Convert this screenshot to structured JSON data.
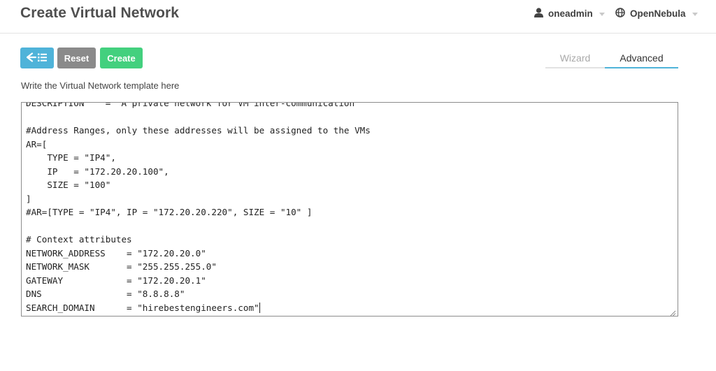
{
  "header": {
    "title": "Create Virtual Network",
    "user": {
      "name": "oneadmin",
      "icon": "user-icon"
    },
    "zone": {
      "name": "OpenNebula",
      "icon": "globe-icon"
    }
  },
  "toolbar": {
    "back_icon": "back-list-icon",
    "reset_label": "Reset",
    "create_label": "Create",
    "colors": {
      "back": "#4fb3d9",
      "reset": "#8a8a8a",
      "create": "#43d07e"
    }
  },
  "tabs": [
    {
      "label": "Wizard",
      "active": false
    },
    {
      "label": "Advanced",
      "active": true
    }
  ],
  "editor": {
    "instructions": "Write the Virtual Network template here",
    "lines": [
      "DESCRIPTION    = \"A private network for VM inter-communication\"",
      "",
      "#Address Ranges, only these addresses will be assigned to the VMs",
      "AR=[",
      "    TYPE = \"IP4\",",
      "    IP   = \"172.20.20.100\",",
      "    SIZE = \"100\"",
      "]",
      "#AR=[TYPE = \"IP4\", IP = \"172.20.20.220\", SIZE = \"10\" ]",
      "",
      "# Context attributes",
      "NETWORK_ADDRESS    = \"172.20.20.0\"",
      "NETWORK_MASK       = \"255.255.255.0\"",
      "GATEWAY            = \"172.20.20.1\"",
      "DNS                = \"8.8.8.8\"",
      "SEARCH_DOMAIN      = \"hirebestengineers.com\""
    ]
  }
}
